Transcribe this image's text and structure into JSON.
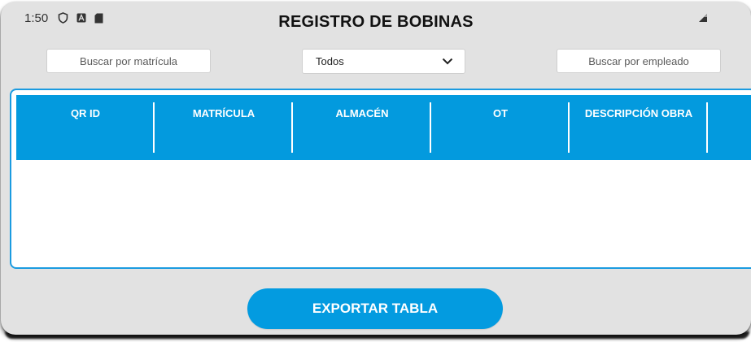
{
  "status_bar": {
    "time": "1:50",
    "icons": [
      "shield-icon",
      "font-a-icon",
      "sd-card-icon"
    ],
    "signal_icon": "signal-icon"
  },
  "title": "REGISTRO DE BOBINAS",
  "filters": {
    "matricula_placeholder": "Buscar por matrícula",
    "select_value": "Todos",
    "empleado_placeholder": "Buscar por empleado"
  },
  "table": {
    "columns": [
      "QR ID",
      "MATRÍCULA",
      "ALMACÉN",
      "OT",
      "DESCRIPCIÓN OBRA"
    ],
    "rows": []
  },
  "export_button_label": "EXPORTAR TABLA",
  "colors": {
    "accent": "#039ade",
    "background": "#e2e2e2"
  }
}
